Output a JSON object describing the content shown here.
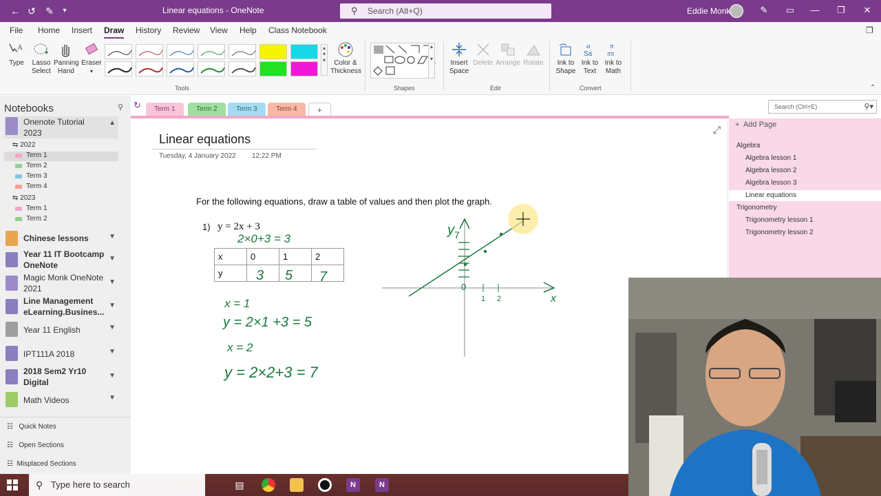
{
  "titlebar": {
    "title": "Linear equations - OneNote",
    "search_placeholder": "Search (Alt+Q)",
    "user": "Eddie Monk"
  },
  "menu": [
    "File",
    "Home",
    "Insert",
    "Draw",
    "History",
    "Review",
    "View",
    "Help",
    "Class Notebook"
  ],
  "ribbon": {
    "type": "Type",
    "lasso": [
      "Lasso",
      "Select"
    ],
    "pan": [
      "Panning",
      "Hand"
    ],
    "eraser": "Eraser",
    "color_thickness": [
      "Color &",
      "Thickness"
    ],
    "insert_space": [
      "Insert",
      "Space"
    ],
    "delete": "Delete",
    "arrange": "Arrange",
    "rotate": "Rotate",
    "ink_shape": [
      "Ink to",
      "Shape"
    ],
    "ink_text": [
      "Ink to",
      "Text"
    ],
    "ink_math": [
      "Ink to",
      "Math"
    ],
    "groups": {
      "tools": "Tools",
      "shapes": "Shapes",
      "edit": "Edit",
      "convert": "Convert"
    }
  },
  "sidebar": {
    "header": "Notebooks",
    "notebooks": [
      {
        "name": "Onenote Tutorial 2023",
        "color": "#9b8cc9"
      },
      {
        "name": "Chinese lessons",
        "color": "#e9a450"
      },
      {
        "name": "Year 11 IT Bootcamp OneNote",
        "color": "#8b7fc0"
      },
      {
        "name": "Magic Monk OneNote 2021",
        "color": "#9b8cc9"
      },
      {
        "name": "Line Management eLearning.Busines...",
        "color": "#8b7fc0"
      },
      {
        "name": "Year 11 English",
        "color": "#9e9e9e"
      },
      {
        "name": "IPT111A 2018",
        "color": "#8b7fc0"
      },
      {
        "name": "2018 Sem2 Yr10 Digital",
        "color": "#8b7fc0"
      },
      {
        "name": "Math Videos",
        "color": "#9ccc65"
      }
    ],
    "groups": [
      "2022",
      "2023"
    ],
    "sections_2022": [
      {
        "name": "Term 1",
        "color": "#f1a7c8"
      },
      {
        "name": "Term 2",
        "color": "#8fd18f"
      },
      {
        "name": "Term 3",
        "color": "#7ec8e3"
      },
      {
        "name": "Term 4",
        "color": "#f4a08e"
      }
    ],
    "sections_2023": [
      {
        "name": "Term 1",
        "color": "#f1a7c8"
      },
      {
        "name": "Term 2",
        "color": "#8fd18f"
      }
    ],
    "footer": [
      "Quick Notes",
      "Open Sections",
      "Misplaced Sections"
    ]
  },
  "section_tabs": [
    {
      "name": "Term 1",
      "color": "#f9c5dc",
      "text": "#8a3d62"
    },
    {
      "name": "Term 2",
      "color": "#9fe0a0",
      "text": "#2d6a2d"
    },
    {
      "name": "Term 3",
      "color": "#a6dcef",
      "text": "#2b6680"
    },
    {
      "name": "Term 4",
      "color": "#f7b8a6",
      "text": "#8a3b2a"
    }
  ],
  "add_tab": "+",
  "page": {
    "title": "Linear equations",
    "date": "Tuesday, 4 January 2022",
    "time": "12:22 PM",
    "prompt": "For the following equations, draw a table of values and then plot the graph.",
    "eq_number": "1)",
    "equation": "y = 2x + 3",
    "table": {
      "rows": [
        [
          "x",
          "0",
          "1",
          "2"
        ],
        [
          "y",
          "",
          "",
          ""
        ]
      ]
    },
    "ink": {
      "sub_line": "2×0+3 = 3",
      "table_y": [
        "3",
        "5",
        "7"
      ],
      "work1": "x = 1",
      "work2": "y = 2×1 +3  = 5",
      "work3": "x = 2",
      "work4": "y = 2×2+3 = 7",
      "axis_y": "y",
      "axis_x": "x",
      "tick0": "0",
      "tick1": "1",
      "tick2": "2",
      "tick_y": "7"
    }
  },
  "pagelist": {
    "search_placeholder": "Search (Ctrl+E)",
    "add_page": "Add Page",
    "items": [
      {
        "label": "Algebra",
        "level": 0
      },
      {
        "label": "Algebra lesson 1",
        "level": 1
      },
      {
        "label": "Algebra lesson 2",
        "level": 1
      },
      {
        "label": "Algebra lesson 3",
        "level": 1
      },
      {
        "label": "Linear equations",
        "level": 1,
        "selected": true
      },
      {
        "label": "Trigonometry",
        "level": 0
      },
      {
        "label": "Trigonometry lesson 1",
        "level": 1
      },
      {
        "label": "Trigonometry lesson 2",
        "level": 1
      }
    ]
  },
  "taskbar": {
    "search_placeholder": "Type here to search"
  }
}
